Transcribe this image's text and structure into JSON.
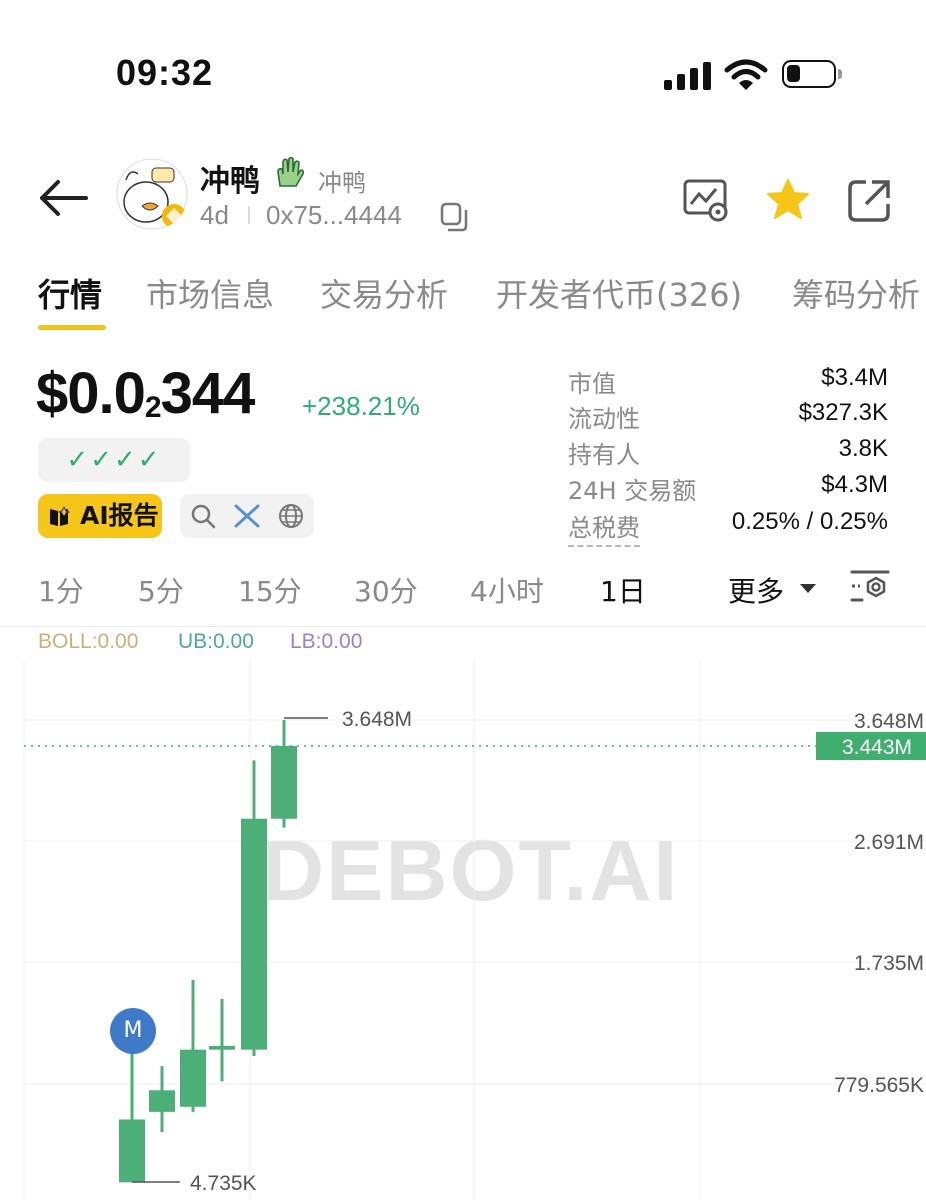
{
  "status_bar": {
    "time": "09:32"
  },
  "token": {
    "name": "冲鸭",
    "subname": "冲鸭",
    "age": "4d",
    "address": "0x75...4444",
    "price_main": "$0.0",
    "price_zeros": "2",
    "price_tail": "344",
    "change": "+238.21%",
    "checks": "✓✓✓✓",
    "ai_report_label": "AI报告"
  },
  "tabs": [
    "行情",
    "市场信息",
    "交易分析",
    "开发者代币(326)",
    "筹码分析"
  ],
  "stats": [
    {
      "label": "市值",
      "value": "$3.4M"
    },
    {
      "label": "流动性",
      "value": "$327.3K"
    },
    {
      "label": "持有人",
      "value": "3.8K"
    },
    {
      "label": "24H 交易额",
      "value": "$4.3M"
    },
    {
      "label": "总税费",
      "value": "0.25% / 0.25%"
    }
  ],
  "intervals": [
    "1分",
    "5分",
    "15分",
    "30分",
    "4小时",
    "1日"
  ],
  "active_interval": "1日",
  "more_label": "更多",
  "indicators": {
    "boll": "BOLL:0.00",
    "ub": "UB:0.00",
    "lb": "LB:0.00"
  },
  "watermark": "DEBOT.AI",
  "marker_label": "M",
  "colors": {
    "up": "#4caf78",
    "accent": "#F5C518",
    "price_tag": "#3fae6f"
  },
  "chart_data": {
    "type": "candlestick",
    "y_axis_labels": [
      "3.648M",
      "2.691M",
      "1.735M",
      "779.565K"
    ],
    "current_price_label": "3.443M",
    "high_label": "3.648M",
    "low_label": "4.735K",
    "candles": [
      {
        "open": 4735,
        "close": 500000,
        "low": 4735,
        "high": 1150000
      },
      {
        "open": 560000,
        "close": 730000,
        "low": 400000,
        "high": 920000
      },
      {
        "open": 600000,
        "close": 1050000,
        "low": 560000,
        "high": 1600000
      },
      {
        "open": 1050000,
        "close": 1080000,
        "low": 800000,
        "high": 1450000
      },
      {
        "open": 1050000,
        "close": 2870000,
        "low": 1000000,
        "high": 3330000
      },
      {
        "open": 2870000,
        "close": 3443000,
        "low": 2800000,
        "high": 3648000
      }
    ]
  }
}
